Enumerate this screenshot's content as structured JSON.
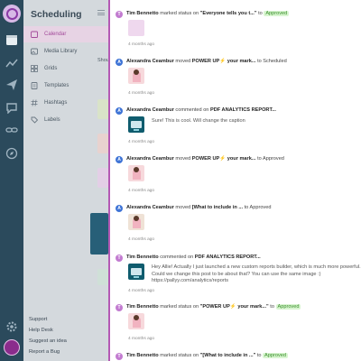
{
  "sidebar": {
    "title": "Scheduling",
    "items": [
      {
        "label": "Calendar",
        "icon": "calendar-icon",
        "active": true
      },
      {
        "label": "Media Library",
        "icon": "image-icon"
      },
      {
        "label": "Grids",
        "icon": "grid-icon"
      },
      {
        "label": "Templates",
        "icon": "template-icon"
      },
      {
        "label": "Hashtags",
        "icon": "hashtag-icon"
      },
      {
        "label": "Labels",
        "icon": "label-icon"
      }
    ],
    "footer": [
      "Support",
      "Help Desk",
      "Suggest an idea",
      "Report a Bug"
    ]
  },
  "peek": {
    "label": "Shou"
  },
  "activity": [
    {
      "avatar": "T",
      "user": "Tim Bennetto",
      "action": "marked status on",
      "post": "\"Everyone tells you t...\"",
      "suffix": "to",
      "status": "Approved",
      "time": "4 months ago",
      "thumb": "plain"
    },
    {
      "avatar": "A",
      "user": "Alexandra Ceambur",
      "action": "moved",
      "post": "POWER UP",
      "post2": "your mark...",
      "suffix": "to Scheduled",
      "time": "4 months ago",
      "thumb": "photo"
    },
    {
      "avatar": "A",
      "user": "Alexandra Ceambur",
      "action": "commented on",
      "post": "PDF ANALYTICS REPORT...",
      "comment": "Sure! This is cool. Will change the caption",
      "time": "4 months ago",
      "thumb": "pdf"
    },
    {
      "avatar": "A",
      "user": "Alexandra Ceambur",
      "action": "moved",
      "post": "POWER UP",
      "post2": "your mark...",
      "suffix": "to Approved",
      "time": "4 months ago",
      "thumb": "photo"
    },
    {
      "avatar": "A",
      "user": "Alexandra Ceambur",
      "action": "moved",
      "post": "[What to include in ...",
      "suffix": "to Approved",
      "time": "4 months ago",
      "thumb": "photo"
    },
    {
      "avatar": "T",
      "user": "Tim Bennetto",
      "action": "commented on",
      "post": "PDF ANALYTICS REPORT...",
      "comment": "Hey Allie! Actually I just launched a new custom reports builder, which is much more powerful. Could we change this post to be about that? You can use the same image :) https://pallyy.com/analytics/reports",
      "time": "4 months ago",
      "thumb": "pdf"
    },
    {
      "avatar": "T",
      "user": "Tim Bennetto",
      "action": "marked status on",
      "post": "\"POWER UP",
      "post2": "your mark...\"",
      "suffix": "to",
      "status": "Approved",
      "time": "4 months ago",
      "thumb": "photo"
    },
    {
      "avatar": "T",
      "user": "Tim Bennetto",
      "action": "marked status on",
      "post": "\"[What to include in ...\"",
      "suffix": "to",
      "status": "Approved",
      "time": "",
      "thumb": "none"
    }
  ]
}
